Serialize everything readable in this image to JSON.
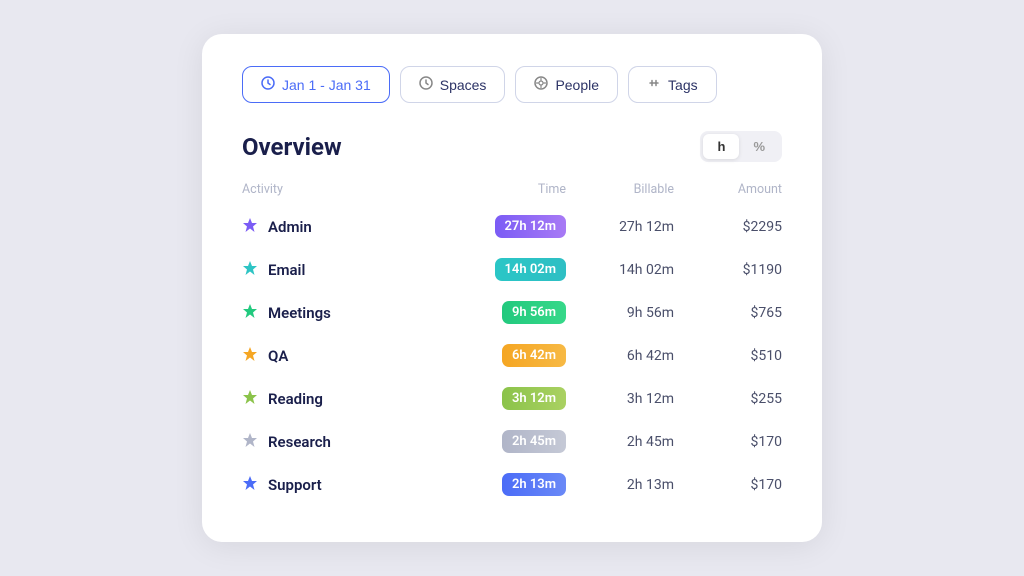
{
  "filters": [
    {
      "id": "date",
      "label": "Jan 1 - Jan 31",
      "icon": "🕐",
      "active": true
    },
    {
      "id": "spaces",
      "label": "Spaces",
      "icon": "🕐",
      "active": false
    },
    {
      "id": "people",
      "label": "People",
      "icon": "@",
      "active": false
    },
    {
      "id": "tags",
      "label": "Tags",
      "icon": "#",
      "active": false
    }
  ],
  "overview": {
    "title": "Overview",
    "toggle": {
      "hours_label": "h",
      "percent_label": "%",
      "active": "h"
    }
  },
  "table": {
    "headers": {
      "activity": "Activity",
      "time": "Time",
      "billable": "Billable",
      "amount": "Amount"
    },
    "rows": [
      {
        "name": "Admin",
        "star_color": "#7b5cf5",
        "badge_color": "#7b5cf5",
        "badge_gradient": "linear-gradient(90deg,#7b5cf5,#a87af5)",
        "time": "27h 12m",
        "billable": "27h 12m",
        "amount": "$2295"
      },
      {
        "name": "Email",
        "star_color": "#2ec4c4",
        "badge_color": "#2ec4c4",
        "badge_gradient": "linear-gradient(90deg,#2ac6c6,#2ebfc4)",
        "time": "14h 02m",
        "billable": "14h 02m",
        "amount": "$1190"
      },
      {
        "name": "Meetings",
        "star_color": "#22c97e",
        "badge_color": "#22c97e",
        "badge_gradient": "linear-gradient(90deg,#22c97e,#36d889)",
        "time": "9h 56m",
        "billable": "9h 56m",
        "amount": "$765"
      },
      {
        "name": "QA",
        "star_color": "#f5a623",
        "badge_color": "#f5a623",
        "badge_gradient": "linear-gradient(90deg,#f5a623,#f7b944)",
        "time": "6h 42m",
        "billable": "6h 42m",
        "amount": "$510"
      },
      {
        "name": "Reading",
        "star_color": "#8bc34a",
        "badge_color": "#8bc34a",
        "badge_gradient": "linear-gradient(90deg,#8bc34a,#aad162)",
        "time": "3h 12m",
        "billable": "3h 12m",
        "amount": "$255"
      },
      {
        "name": "Research",
        "star_color": "#b0b5c8",
        "badge_color": "#b0b5c8",
        "badge_gradient": "linear-gradient(90deg,#b0b5c8,#c5c9d6)",
        "time": "2h 45m",
        "billable": "2h 45m",
        "amount": "$170"
      },
      {
        "name": "Support",
        "star_color": "#4b6cf7",
        "badge_color": "#4b6cf7",
        "badge_gradient": "linear-gradient(90deg,#4b6cf7,#6a89f7)",
        "time": "2h 13m",
        "billable": "2h 13m",
        "amount": "$170"
      }
    ]
  }
}
